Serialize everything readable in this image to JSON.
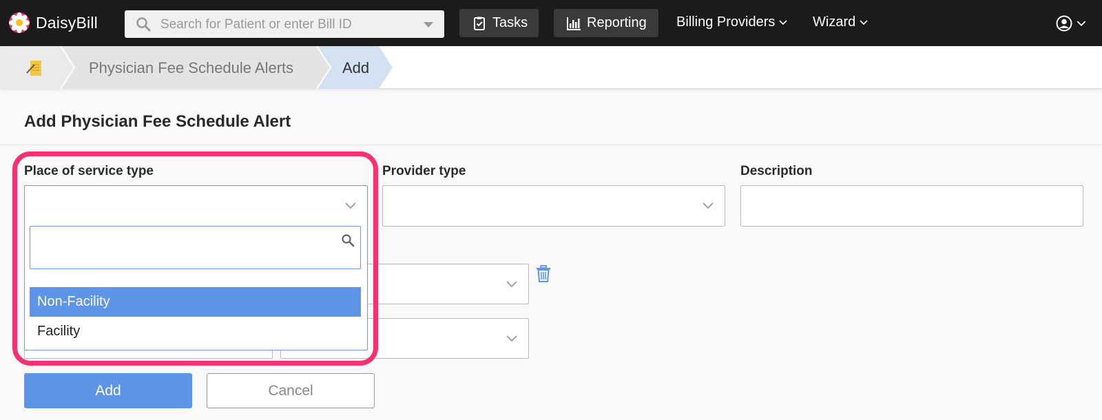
{
  "nav": {
    "brand": "DaisyBill",
    "search_placeholder": "Search for Patient or enter Bill ID",
    "tasks": "Tasks",
    "reporting": "Reporting",
    "billing_providers": "Billing Providers",
    "wizard": "Wizard"
  },
  "breadcrumb": {
    "items": [
      "Physician Fee Schedule Alerts",
      "Add"
    ]
  },
  "page": {
    "title": "Add Physician Fee Schedule Alert"
  },
  "form": {
    "place_of_service_label": "Place of service type",
    "provider_type_label": "Provider type",
    "description_label": "Description",
    "place_of_service_options": [
      "Non-Facility",
      "Facility"
    ],
    "selected_highlight": "Non-Facility",
    "add_label": "Add",
    "cancel_label": "Cancel"
  },
  "colors": {
    "nav_bg": "#1b1b1b",
    "accent_blue": "#5e95e6",
    "highlight_pink": "#f5316f",
    "breadcrumb_active": "#d3e1f3"
  },
  "icons": [
    "daisy-logo-icon",
    "search-icon",
    "clipboard-check-icon",
    "bar-chart-icon",
    "chevron-down-icon",
    "user-circle-icon",
    "note-edit-icon",
    "trash-icon"
  ]
}
